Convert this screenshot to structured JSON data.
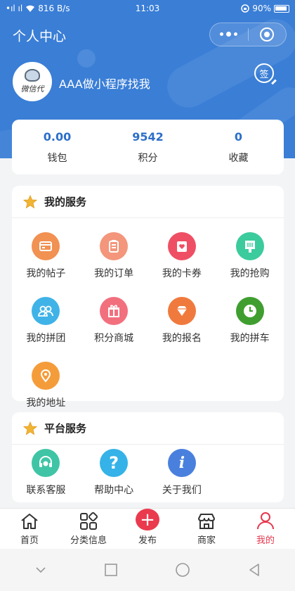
{
  "status_bar": {
    "signal": "•ıl ıl",
    "speed": "816 B/s",
    "time": "11:03",
    "battery": "90%"
  },
  "header": {
    "title": "个人中心"
  },
  "profile": {
    "name": "AAA做小程序找我",
    "avatar_text": "微信代",
    "sign_label": "签"
  },
  "stats": [
    {
      "value": "0.00",
      "label": "钱包"
    },
    {
      "value": "9542",
      "label": "积分"
    },
    {
      "value": "0",
      "label": "收藏"
    }
  ],
  "my_services": {
    "title": "我的服务",
    "items": [
      {
        "label": "我的帖子",
        "icon": "post-icon",
        "color": "#f19152"
      },
      {
        "label": "我的订单",
        "icon": "order-icon",
        "color": "#f3967b"
      },
      {
        "label": "我的卡券",
        "icon": "coupon-icon",
        "color": "#ef4f64"
      },
      {
        "label": "我的抢购",
        "icon": "flash-sale-icon",
        "color": "#3ccb9c"
      },
      {
        "label": "我的拼团",
        "icon": "group-buy-icon",
        "color": "#3fb3e8"
      },
      {
        "label": "积分商城",
        "icon": "gift-icon",
        "color": "#f2707e"
      },
      {
        "label": "我的报名",
        "icon": "diamond-icon",
        "color": "#f07a3d"
      },
      {
        "label": "我的拼车",
        "icon": "clock-icon",
        "color": "#3f9e2f"
      },
      {
        "label": "我的地址",
        "icon": "location-icon",
        "color": "#f59c3a"
      }
    ]
  },
  "platform_services": {
    "title": "平台服务",
    "items": [
      {
        "label": "联系客服",
        "icon": "headset-icon",
        "color": "#3fc5a6"
      },
      {
        "label": "帮助中心",
        "icon": "help-icon",
        "color": "#35b2e8"
      },
      {
        "label": "关于我们",
        "icon": "info-icon",
        "color": "#4a80dd"
      }
    ]
  },
  "tabbar": [
    {
      "label": "首页",
      "icon": "home-icon"
    },
    {
      "label": "分类信息",
      "icon": "category-icon"
    },
    {
      "label": "发布",
      "icon": "plus-icon"
    },
    {
      "label": "商家",
      "icon": "store-icon"
    },
    {
      "label": "我的",
      "icon": "user-icon",
      "active": true
    }
  ],
  "colors": {
    "primary": "#3a7ed6",
    "accent": "#e5384f",
    "stat_value": "#2d6fc9"
  }
}
